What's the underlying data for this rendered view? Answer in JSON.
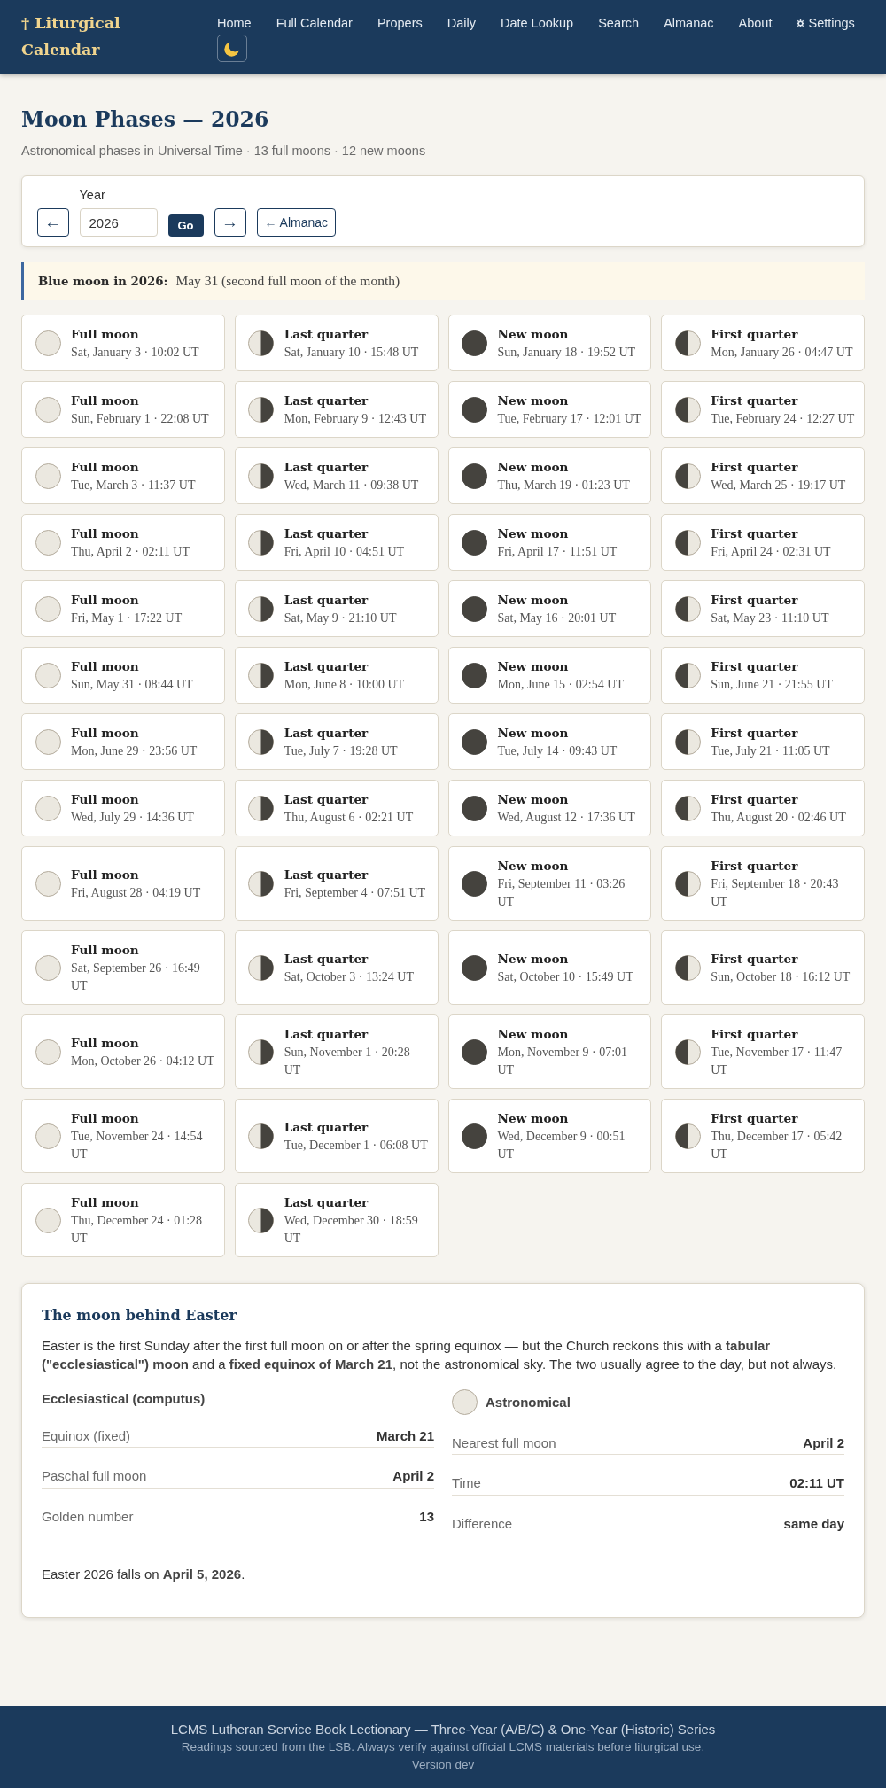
{
  "header": {
    "brand": "† Liturgical Calendar",
    "nav": [
      {
        "label": "Home",
        "kind": "link"
      },
      {
        "label": "Full Calendar",
        "kind": "link"
      },
      {
        "label": "Propers",
        "kind": "link"
      },
      {
        "label": "Daily",
        "kind": "link"
      },
      {
        "label": "Date Lookup",
        "kind": "link"
      },
      {
        "label": "Search",
        "kind": "link"
      },
      {
        "label": "Almanac",
        "kind": "link"
      },
      {
        "label": "About",
        "kind": "link"
      },
      {
        "label": "Settings",
        "kind": "settings"
      }
    ]
  },
  "page": {
    "title": "Moon Phases — 2026",
    "subtitle": "Astronomical phases in Universal Time · 13 full moons · 12 new moons"
  },
  "year_form": {
    "prev_button": "←",
    "year_field": {
      "label": "Year",
      "value": "2026"
    },
    "go_button": "Go",
    "next_button": "→",
    "almanac_button": "← Almanac"
  },
  "blue_moon": {
    "label": "Blue moon in 2026:",
    "text": "May 31 (second full moon of the month)"
  },
  "phases": [
    {
      "kind": "full",
      "name": "Full moon",
      "when": "Sat, January 3 · 10:02 UT"
    },
    {
      "kind": "last_quarter",
      "name": "Last quarter",
      "when": "Sat, January 10 · 15:48 UT"
    },
    {
      "kind": "new",
      "name": "New moon",
      "when": "Sun, January 18 · 19:52 UT"
    },
    {
      "kind": "first_quarter",
      "name": "First quarter",
      "when": "Mon, January 26 · 04:47 UT"
    },
    {
      "kind": "full",
      "name": "Full moon",
      "when": "Sun, February 1 · 22:08 UT"
    },
    {
      "kind": "last_quarter",
      "name": "Last quarter",
      "when": "Mon, February 9 · 12:43 UT"
    },
    {
      "kind": "new",
      "name": "New moon",
      "when": "Tue, February 17 · 12:01 UT"
    },
    {
      "kind": "first_quarter",
      "name": "First quarter",
      "when": "Tue, February 24 · 12:27 UT"
    },
    {
      "kind": "full",
      "name": "Full moon",
      "when": "Tue, March 3 · 11:37 UT"
    },
    {
      "kind": "last_quarter",
      "name": "Last quarter",
      "when": "Wed, March 11 · 09:38 UT"
    },
    {
      "kind": "new",
      "name": "New moon",
      "when": "Thu, March 19 · 01:23 UT"
    },
    {
      "kind": "first_quarter",
      "name": "First quarter",
      "when": "Wed, March 25 · 19:17 UT"
    },
    {
      "kind": "full",
      "name": "Full moon",
      "when": "Thu, April 2 · 02:11 UT"
    },
    {
      "kind": "last_quarter",
      "name": "Last quarter",
      "when": "Fri, April 10 · 04:51 UT"
    },
    {
      "kind": "new",
      "name": "New moon",
      "when": "Fri, April 17 · 11:51 UT"
    },
    {
      "kind": "first_quarter",
      "name": "First quarter",
      "when": "Fri, April 24 · 02:31 UT"
    },
    {
      "kind": "full",
      "name": "Full moon",
      "when": "Fri, May 1 · 17:22 UT"
    },
    {
      "kind": "last_quarter",
      "name": "Last quarter",
      "when": "Sat, May 9 · 21:10 UT"
    },
    {
      "kind": "new",
      "name": "New moon",
      "when": "Sat, May 16 · 20:01 UT"
    },
    {
      "kind": "first_quarter",
      "name": "First quarter",
      "when": "Sat, May 23 · 11:10 UT"
    },
    {
      "kind": "full",
      "name": "Full moon",
      "when": "Sun, May 31 · 08:44 UT"
    },
    {
      "kind": "last_quarter",
      "name": "Last quarter",
      "when": "Mon, June 8 · 10:00 UT"
    },
    {
      "kind": "new",
      "name": "New moon",
      "when": "Mon, June 15 · 02:54 UT"
    },
    {
      "kind": "first_quarter",
      "name": "First quarter",
      "when": "Sun, June 21 · 21:55 UT"
    },
    {
      "kind": "full",
      "name": "Full moon",
      "when": "Mon, June 29 · 23:56 UT"
    },
    {
      "kind": "last_quarter",
      "name": "Last quarter",
      "when": "Tue, July 7 · 19:28 UT"
    },
    {
      "kind": "new",
      "name": "New moon",
      "when": "Tue, July 14 · 09:43 UT"
    },
    {
      "kind": "first_quarter",
      "name": "First quarter",
      "when": "Tue, July 21 · 11:05 UT"
    },
    {
      "kind": "full",
      "name": "Full moon",
      "when": "Wed, July 29 · 14:36 UT"
    },
    {
      "kind": "last_quarter",
      "name": "Last quarter",
      "when": "Thu, August 6 · 02:21 UT"
    },
    {
      "kind": "new",
      "name": "New moon",
      "when": "Wed, August 12 · 17:36 UT"
    },
    {
      "kind": "first_quarter",
      "name": "First quarter",
      "when": "Thu, August 20 · 02:46 UT"
    },
    {
      "kind": "full",
      "name": "Full moon",
      "when": "Fri, August 28 · 04:19 UT"
    },
    {
      "kind": "last_quarter",
      "name": "Last quarter",
      "when": "Fri, September 4 · 07:51 UT"
    },
    {
      "kind": "new",
      "name": "New moon",
      "when": "Fri, September 11 · 03:26 UT"
    },
    {
      "kind": "first_quarter",
      "name": "First quarter",
      "when": "Fri, September 18 · 20:43 UT"
    },
    {
      "kind": "full",
      "name": "Full moon",
      "when": "Sat, September 26 · 16:49 UT"
    },
    {
      "kind": "last_quarter",
      "name": "Last quarter",
      "when": "Sat, October 3 · 13:24 UT"
    },
    {
      "kind": "new",
      "name": "New moon",
      "when": "Sat, October 10 · 15:49 UT"
    },
    {
      "kind": "first_quarter",
      "name": "First quarter",
      "when": "Sun, October 18 · 16:12 UT"
    },
    {
      "kind": "full",
      "name": "Full moon",
      "when": "Mon, October 26 · 04:12 UT"
    },
    {
      "kind": "last_quarter",
      "name": "Last quarter",
      "when": "Sun, November 1 · 20:28 UT"
    },
    {
      "kind": "new",
      "name": "New moon",
      "when": "Mon, November 9 · 07:01 UT"
    },
    {
      "kind": "first_quarter",
      "name": "First quarter",
      "when": "Tue, November 17 · 11:47 UT"
    },
    {
      "kind": "full",
      "name": "Full moon",
      "when": "Tue, November 24 · 14:54 UT"
    },
    {
      "kind": "last_quarter",
      "name": "Last quarter",
      "when": "Tue, December 1 · 06:08 UT"
    },
    {
      "kind": "new",
      "name": "New moon",
      "when": "Wed, December 9 · 00:51 UT"
    },
    {
      "kind": "first_quarter",
      "name": "First quarter",
      "when": "Thu, December 17 · 05:42 UT"
    },
    {
      "kind": "full",
      "name": "Full moon",
      "when": "Thu, December 24 · 01:28 UT"
    },
    {
      "kind": "last_quarter",
      "name": "Last quarter",
      "when": "Wed, December 30 · 18:59 UT"
    }
  ],
  "easter": {
    "title": "The moon behind Easter",
    "intro": "Easter is the first Sunday after the first full moon on or after the spring equinox — but the Church reckons this with a **tabular (\"ecclesiastical\") moon** and a **fixed equinox of March 21**, not the astronomical sky. The two usually agree to the day, but not always.",
    "ecclesiastical": {
      "heading": "Ecclesiastical (computus)",
      "rows": [
        {
          "label": "Equinox (fixed)",
          "value": "March 21"
        },
        {
          "label": "Paschal full moon",
          "value": "April 2"
        },
        {
          "label": "Golden number",
          "value": "13"
        }
      ]
    },
    "astronomical": {
      "heading": "Astronomical",
      "rows": [
        {
          "label": "Nearest full moon",
          "value": "April 2"
        },
        {
          "label": "Time",
          "value": "02:11 UT"
        },
        {
          "label": "Difference",
          "value": "same day"
        }
      ]
    },
    "note": "Easter 2026 falls on **April 5, 2026**."
  },
  "footer": {
    "title": "LCMS Lutheran Service Book Lectionary — Three-Year (A/B/C) & One-Year (Historic) Series",
    "disclaimer": "Readings sourced from the LSB. Always verify against official LCMS materials before liturgical use.",
    "version": "Version dev"
  }
}
